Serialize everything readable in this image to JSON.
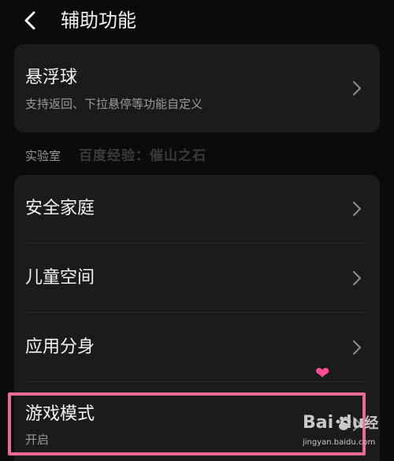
{
  "header": {
    "title": "辅助功能"
  },
  "floating_ball": {
    "title": "悬浮球",
    "subtitle": "支持返回、下拉悬停等功能自定义"
  },
  "lab_section": {
    "label": "实验室",
    "watermark": "百度经验：催山之石"
  },
  "lab_items": [
    {
      "title": "安全家庭"
    },
    {
      "title": "儿童空间"
    },
    {
      "title": "应用分身"
    },
    {
      "title": "游戏模式",
      "status": "开启"
    }
  ],
  "overlay": {
    "heart": "❤",
    "baidu_wordmark": "Bai  du",
    "baidu_suffix": "经",
    "baidu_url": "jingyan.baidu.com"
  },
  "colors": {
    "background": "#0b0b0b",
    "card": "#1b1b1b",
    "highlight": "#e86c95",
    "heart": "#ff4f8f"
  }
}
